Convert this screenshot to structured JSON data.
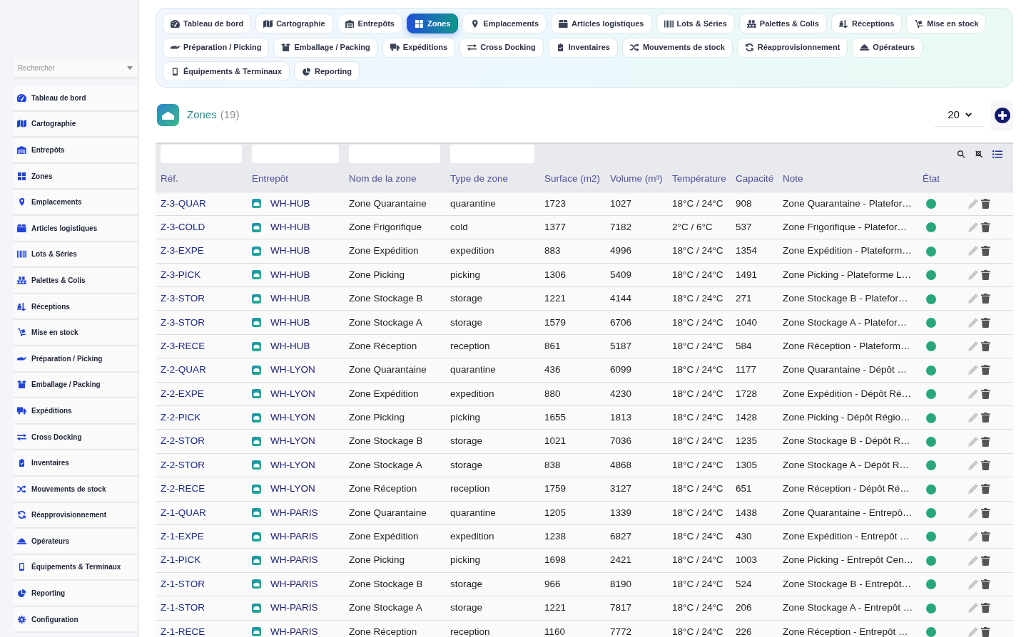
{
  "sidebar": {
    "search": {
      "placeholder": "Rechercher"
    },
    "items": [
      {
        "label": "Tableau de bord"
      },
      {
        "label": "Cartographie"
      },
      {
        "label": "Entrepôts"
      },
      {
        "label": "Zones"
      },
      {
        "label": "Emplacements"
      },
      {
        "label": "Articles logistiques"
      },
      {
        "label": "Lots & Séries"
      },
      {
        "label": "Palettes & Colis"
      },
      {
        "label": "Réceptions"
      },
      {
        "label": "Mise en stock"
      },
      {
        "label": "Préparation / Picking"
      },
      {
        "label": "Emballage / Packing"
      },
      {
        "label": "Expéditions"
      },
      {
        "label": "Cross Docking"
      },
      {
        "label": "Inventaires"
      },
      {
        "label": "Mouvements de stock"
      },
      {
        "label": "Réapprovisionnement"
      },
      {
        "label": "Opérateurs"
      },
      {
        "label": "Équipements & Terminaux"
      },
      {
        "label": "Reporting"
      },
      {
        "label": "Configuration"
      }
    ]
  },
  "module_tabs": [
    {
      "label": "Tableau de bord",
      "selected": false
    },
    {
      "label": "Cartographie",
      "selected": false
    },
    {
      "label": "Entrepôts",
      "selected": false
    },
    {
      "label": "Zones",
      "selected": true
    },
    {
      "label": "Emplacements",
      "selected": false
    },
    {
      "label": "Articles logistiques",
      "selected": false
    },
    {
      "label": "Lots & Séries",
      "selected": false
    },
    {
      "label": "Palettes & Colis",
      "selected": false
    },
    {
      "label": "Réceptions",
      "selected": false
    },
    {
      "label": "Mise en stock",
      "selected": false
    },
    {
      "label": "Préparation / Picking",
      "selected": false
    },
    {
      "label": "Emballage / Packing",
      "selected": false
    },
    {
      "label": "Expéditions",
      "selected": false
    },
    {
      "label": "Cross Docking",
      "selected": false
    },
    {
      "label": "Inventaires",
      "selected": false
    },
    {
      "label": "Mouvements de stock",
      "selected": false
    },
    {
      "label": "Réapprovisionnement",
      "selected": false
    },
    {
      "label": "Opérateurs",
      "selected": false
    },
    {
      "label": "Équipements & Terminaux",
      "selected": false
    },
    {
      "label": "Reporting",
      "selected": false
    }
  ],
  "page_header": {
    "title": "Zones",
    "count": "(19)",
    "page_size": "20"
  },
  "table": {
    "columns": [
      {
        "label": "Réf.",
        "filter": true
      },
      {
        "label": "Entrepôt",
        "filter": true
      },
      {
        "label": "Nom de la zone",
        "filter": true
      },
      {
        "label": "Type de zone",
        "filter": true
      },
      {
        "label": "Surface (m2)",
        "filter": false
      },
      {
        "label": "Volume (m³)",
        "filter": false
      },
      {
        "label": "Température",
        "filter": false
      },
      {
        "label": "Capacité",
        "filter": false
      },
      {
        "label": "Note",
        "filter": false
      },
      {
        "label": "État",
        "filter": false
      }
    ],
    "rows": [
      {
        "ref": "Z-3-QUAR",
        "warehouse": "WH-HUB",
        "name": "Zone Quarantaine",
        "type": "quarantine",
        "surface": "1723",
        "volume": "1027",
        "temperature": "18°C / 24°C",
        "capacity": "908",
        "note": "Zone Quarantaine - Platefor…",
        "active": true
      },
      {
        "ref": "Z-3-COLD",
        "warehouse": "WH-HUB",
        "name": "Zone Frigorifique",
        "type": "cold",
        "surface": "1377",
        "volume": "7182",
        "temperature": "2°C / 6°C",
        "capacity": "537",
        "note": "Zone Frigorifique - Platefor…",
        "active": true
      },
      {
        "ref": "Z-3-EXPE",
        "warehouse": "WH-HUB",
        "name": "Zone Expédition",
        "type": "expedition",
        "surface": "883",
        "volume": "4996",
        "temperature": "18°C / 24°C",
        "capacity": "1354",
        "note": "Zone Expédition - Plateform…",
        "active": true
      },
      {
        "ref": "Z-3-PICK",
        "warehouse": "WH-HUB",
        "name": "Zone Picking",
        "type": "picking",
        "surface": "1306",
        "volume": "5409",
        "temperature": "18°C / 24°C",
        "capacity": "1491",
        "note": "Zone Picking - Plateforme L…",
        "active": true
      },
      {
        "ref": "Z-3-STOR",
        "warehouse": "WH-HUB",
        "name": "Zone Stockage B",
        "type": "storage",
        "surface": "1221",
        "volume": "4144",
        "temperature": "18°C / 24°C",
        "capacity": "271",
        "note": "Zone Stockage B - Platefor…",
        "active": true
      },
      {
        "ref": "Z-3-STOR",
        "warehouse": "WH-HUB",
        "name": "Zone Stockage A",
        "type": "storage",
        "surface": "1579",
        "volume": "6706",
        "temperature": "18°C / 24°C",
        "capacity": "1040",
        "note": "Zone Stockage A - Platefor…",
        "active": true
      },
      {
        "ref": "Z-3-RECE",
        "warehouse": "WH-HUB",
        "name": "Zone Réception",
        "type": "reception",
        "surface": "861",
        "volume": "5187",
        "temperature": "18°C / 24°C",
        "capacity": "584",
        "note": "Zone Réception - Plateform…",
        "active": true
      },
      {
        "ref": "Z-2-QUAR",
        "warehouse": "WH-LYON",
        "name": "Zone Quarantaine",
        "type": "quarantine",
        "surface": "436",
        "volume": "6099",
        "temperature": "18°C / 24°C",
        "capacity": "1177",
        "note": "Zone Quarantaine - Dépôt …",
        "active": true
      },
      {
        "ref": "Z-2-EXPE",
        "warehouse": "WH-LYON",
        "name": "Zone Expédition",
        "type": "expedition",
        "surface": "880",
        "volume": "4230",
        "temperature": "18°C / 24°C",
        "capacity": "1728",
        "note": "Zone Expédition - Dépôt Ré…",
        "active": true
      },
      {
        "ref": "Z-2-PICK",
        "warehouse": "WH-LYON",
        "name": "Zone Picking",
        "type": "picking",
        "surface": "1655",
        "volume": "1813",
        "temperature": "18°C / 24°C",
        "capacity": "1428",
        "note": "Zone Picking - Dépôt Régio…",
        "active": true
      },
      {
        "ref": "Z-2-STOR",
        "warehouse": "WH-LYON",
        "name": "Zone Stockage B",
        "type": "storage",
        "surface": "1021",
        "volume": "7036",
        "temperature": "18°C / 24°C",
        "capacity": "1235",
        "note": "Zone Stockage B - Dépôt R…",
        "active": true
      },
      {
        "ref": "Z-2-STOR",
        "warehouse": "WH-LYON",
        "name": "Zone Stockage A",
        "type": "storage",
        "surface": "838",
        "volume": "4868",
        "temperature": "18°C / 24°C",
        "capacity": "1305",
        "note": "Zone Stockage A - Dépôt R…",
        "active": true
      },
      {
        "ref": "Z-2-RECE",
        "warehouse": "WH-LYON",
        "name": "Zone Réception",
        "type": "reception",
        "surface": "1759",
        "volume": "3127",
        "temperature": "18°C / 24°C",
        "capacity": "651",
        "note": "Zone Réception - Dépôt Ré…",
        "active": true
      },
      {
        "ref": "Z-1-QUAR",
        "warehouse": "WH-PARIS",
        "name": "Zone Quarantaine",
        "type": "quarantine",
        "surface": "1205",
        "volume": "1339",
        "temperature": "18°C / 24°C",
        "capacity": "1438",
        "note": "Zone Quarantaine - Entrepô…",
        "active": true
      },
      {
        "ref": "Z-1-EXPE",
        "warehouse": "WH-PARIS",
        "name": "Zone Expédition",
        "type": "expedition",
        "surface": "1238",
        "volume": "6827",
        "temperature": "18°C / 24°C",
        "capacity": "430",
        "note": "Zone Expédition - Entrepôt …",
        "active": true
      },
      {
        "ref": "Z-1-PICK",
        "warehouse": "WH-PARIS",
        "name": "Zone Picking",
        "type": "picking",
        "surface": "1698",
        "volume": "2421",
        "temperature": "18°C / 24°C",
        "capacity": "1003",
        "note": "Zone Picking - Entrepôt Cen…",
        "active": true
      },
      {
        "ref": "Z-1-STOR",
        "warehouse": "WH-PARIS",
        "name": "Zone Stockage B",
        "type": "storage",
        "surface": "966",
        "volume": "8190",
        "temperature": "18°C / 24°C",
        "capacity": "524",
        "note": "Zone Stockage B - Entrepôt…",
        "active": true
      },
      {
        "ref": "Z-1-STOR",
        "warehouse": "WH-PARIS",
        "name": "Zone Stockage A",
        "type": "storage",
        "surface": "1221",
        "volume": "7817",
        "temperature": "18°C / 24°C",
        "capacity": "206",
        "note": "Zone Stockage A - Entrepôt …",
        "active": true
      },
      {
        "ref": "Z-1-RECE",
        "warehouse": "WH-PARIS",
        "name": "Zone Réception",
        "type": "reception",
        "surface": "1160",
        "volume": "7772",
        "temperature": "18°C / 24°C",
        "capacity": "226",
        "note": "Zone Réception - Entrepôt …",
        "active": true
      }
    ]
  }
}
